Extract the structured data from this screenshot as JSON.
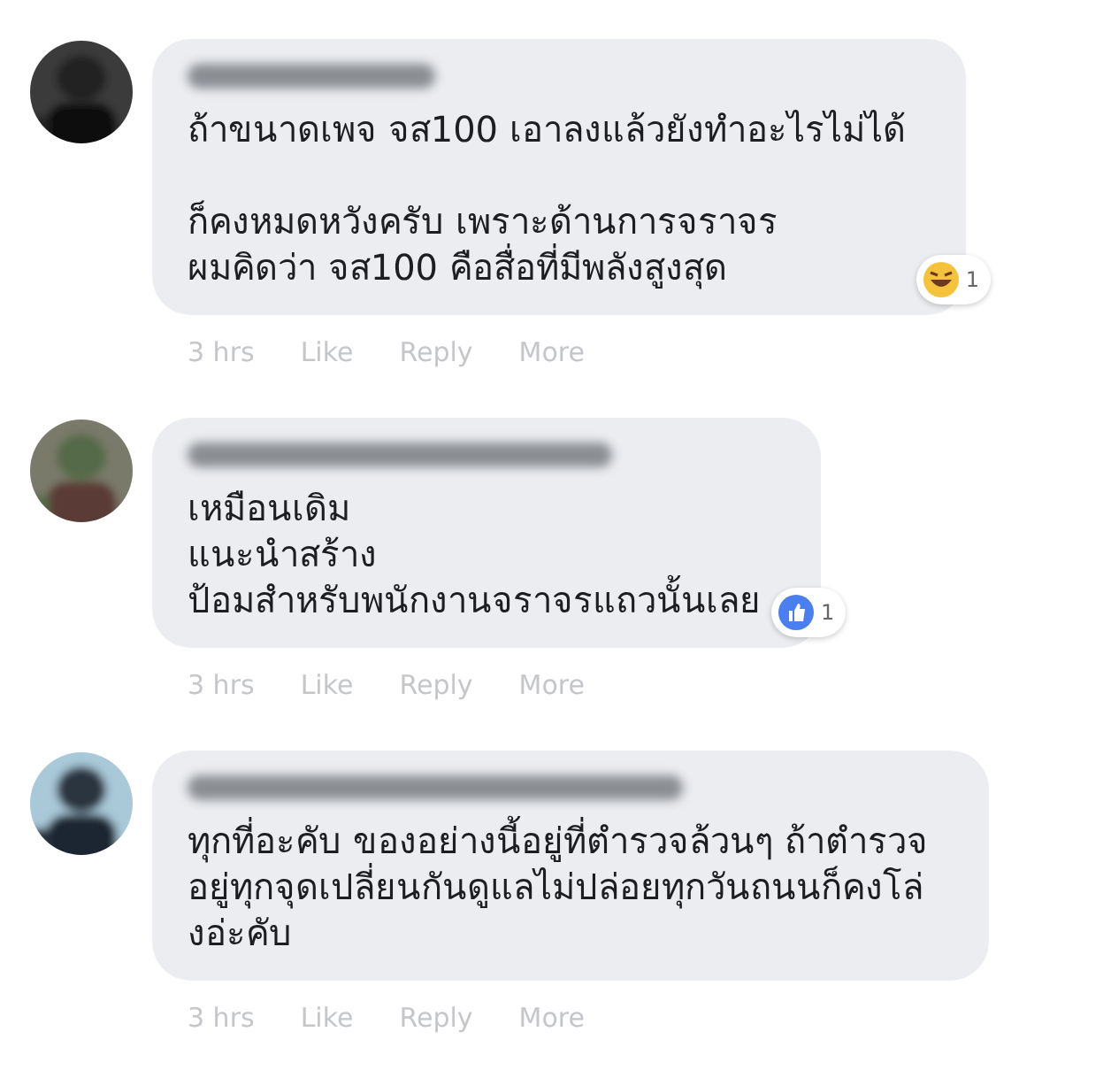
{
  "comments": [
    {
      "avatar": {
        "kind": "picture"
      },
      "paragraphs": [
        [
          "ถ้าขนาดเพจ จส100 เอาลงแล้วยังทำอะไรไม่ได้"
        ],
        [
          "ก็คงหมดหวังครับ เพราะด้านการจราจร",
          "ผมคิดว่า จส100 คือสื่อที่มีพลังสูงสุด"
        ]
      ],
      "reaction": {
        "kind": "haha",
        "count": "1"
      },
      "actions": [
        "3 hrs",
        "Like",
        "Reply",
        "More"
      ]
    },
    {
      "avatar": {
        "kind": "picture"
      },
      "paragraphs": [
        [
          "เหมือนเดิม",
          "แนะนำสร้าง",
          "ป้อมสำหรับพนักงานจราจรแถวนั้นเลย"
        ]
      ],
      "reaction": {
        "kind": "like",
        "count": "1"
      },
      "actions": [
        "3 hrs",
        "Like",
        "Reply",
        "More"
      ]
    },
    {
      "avatar": {
        "kind": "picture"
      },
      "paragraphs": [
        [
          "ทุกที่อะคับ ของอย่างนี้อยู่ที่ตำรวจล้วนๆ ถ้าตำรวจ",
          "อยู่ทุกจุดเปลี่ยนกันดูแลไม่ปล่อยทุกวันถนนก็คงโล่",
          "งอ่ะคับ"
        ]
      ],
      "actions": [
        "3 hrs",
        "Like",
        "Reply",
        "More"
      ]
    }
  ]
}
